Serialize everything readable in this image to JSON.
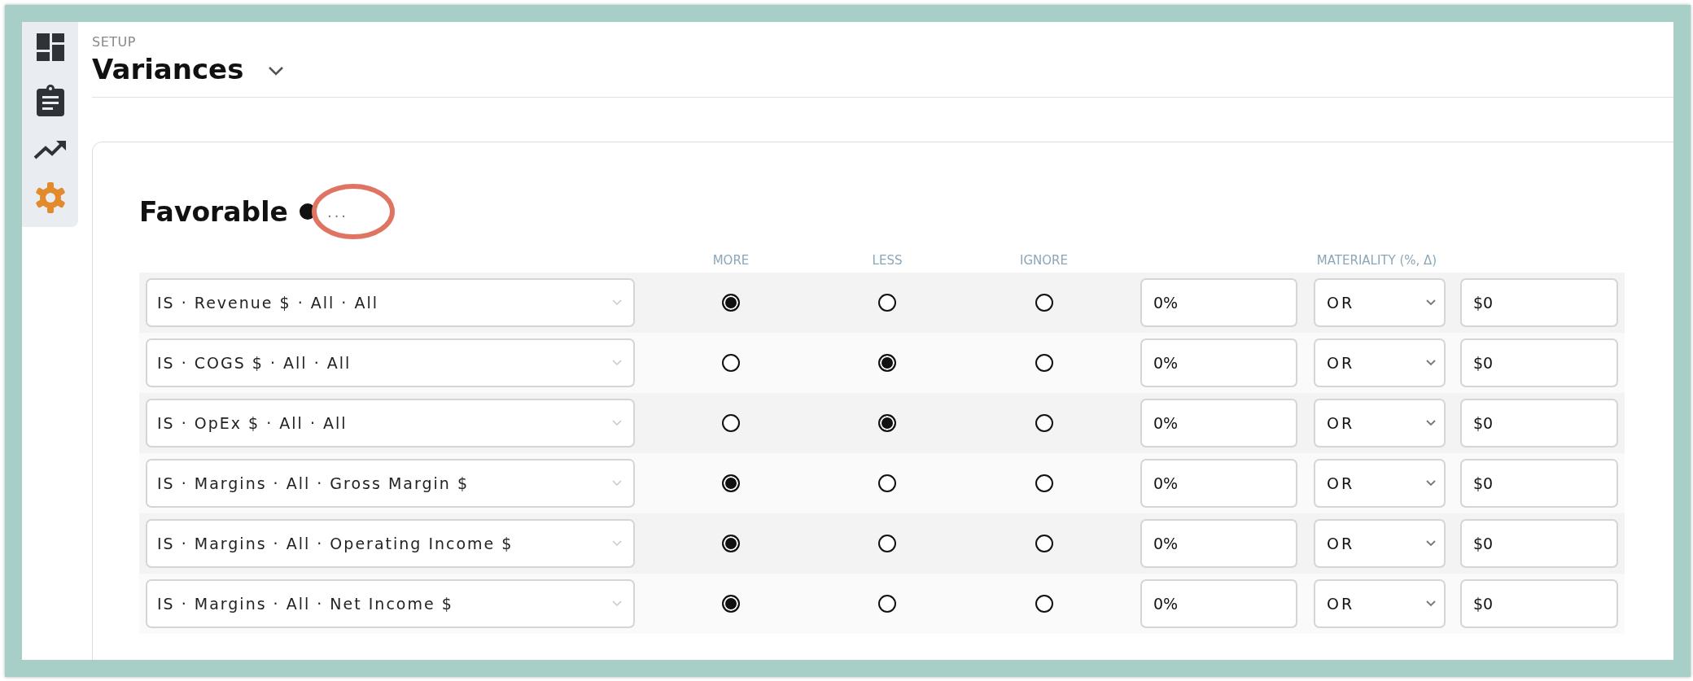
{
  "sidebar": {
    "items": [
      {
        "kind": "dashboard",
        "selected": false
      },
      {
        "kind": "clipboard",
        "selected": false
      },
      {
        "kind": "trend",
        "selected": false
      },
      {
        "kind": "settings",
        "selected": true
      }
    ]
  },
  "header": {
    "breadcrumb": "SETUP",
    "title": "Variances"
  },
  "section": {
    "title": "Favorable",
    "menu": "...",
    "highlighted": true
  },
  "columns": [
    "MORE",
    "LESS",
    "IGNORE"
  ],
  "materiality_label": "MATERIALITY (%, Δ)",
  "rows": [
    {
      "metric": "IS · Revenue $ · All · All",
      "choices": [
        {
          "selected": true
        },
        {
          "selected": false
        },
        {
          "selected": false
        }
      ],
      "percent": "0%",
      "operator": "OR",
      "amount": "$0"
    },
    {
      "metric": "IS · COGS $ · All · All",
      "choices": [
        {
          "selected": false
        },
        {
          "selected": true
        },
        {
          "selected": false
        }
      ],
      "percent": "0%",
      "operator": "OR",
      "amount": "$0"
    },
    {
      "metric": "IS · OpEx $ · All · All",
      "choices": [
        {
          "selected": false
        },
        {
          "selected": true
        },
        {
          "selected": false
        }
      ],
      "percent": "0%",
      "operator": "OR",
      "amount": "$0"
    },
    {
      "metric": "IS · Margins · All · Gross Margin $",
      "choices": [
        {
          "selected": true
        },
        {
          "selected": false
        },
        {
          "selected": false
        }
      ],
      "percent": "0%",
      "operator": "OR",
      "amount": "$0"
    },
    {
      "metric": "IS · Margins · All · Operating Income $",
      "choices": [
        {
          "selected": true
        },
        {
          "selected": false
        },
        {
          "selected": false
        }
      ],
      "percent": "0%",
      "operator": "OR",
      "amount": "$0"
    },
    {
      "metric": "IS · Margins · All · Net Income $",
      "choices": [
        {
          "selected": true
        },
        {
          "selected": false
        },
        {
          "selected": false
        }
      ],
      "percent": "0%",
      "operator": "OR",
      "amount": "$0"
    }
  ]
}
